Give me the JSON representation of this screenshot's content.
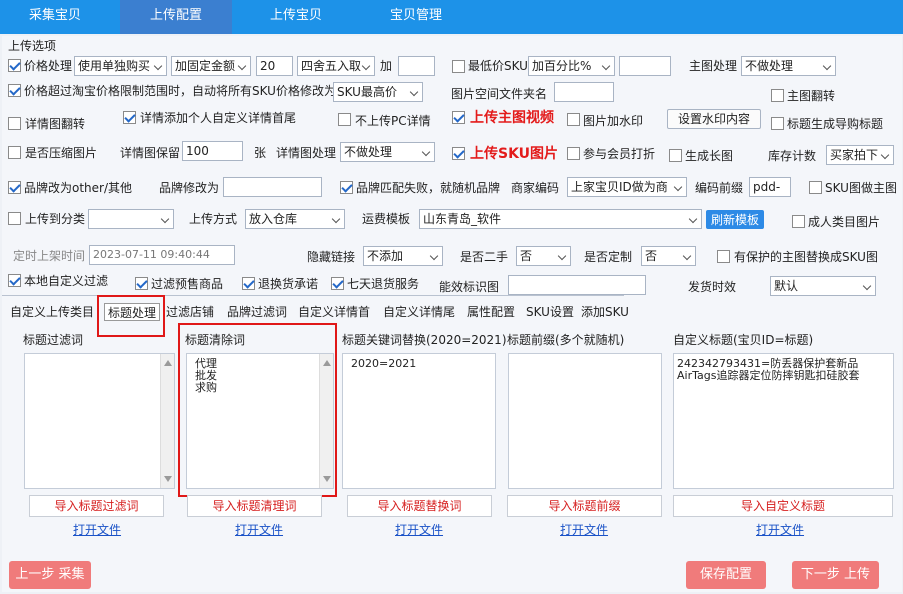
{
  "nav": {
    "tabs": [
      "采集宝贝",
      "上传配置",
      "上传宝贝",
      "宝贝管理"
    ]
  },
  "group_title": "上传选项",
  "row1": {
    "price_label": "价格处理",
    "price_mode": "使用单独购买",
    "fixed_mode": "加固定金额",
    "amount": "20",
    "rounding": "四舍五入取",
    "add": "加",
    "min_price": "最低价SKU",
    "pct": "加百分比%",
    "main_img": "主图处理",
    "main_img_val": "不做处理"
  },
  "row2": {
    "limit": "价格超过淘宝价格限制范围时，自动将所有SKU价格修改为",
    "limit_val": "SKU最高价",
    "folder": "图片空间文件夹名",
    "flip": "主图翻转"
  },
  "row3": {
    "detail_flip": "详情图翻转",
    "add_detail": "详情添加个人自定义详情首尾",
    "no_pc": "不上传PC详情",
    "upload_main_video": "上传主图视频",
    "watermark": "图片加水印",
    "set_watermark": "设置水印内容",
    "title_guide": "标题生成导购标题"
  },
  "row4": {
    "compress": "是否压缩图片",
    "keep": "详情图保留",
    "keep_val": "100",
    "unit": "张",
    "detail_proc": "详情图处理",
    "detail_proc_val": "不做处理",
    "upload_sku": "上传SKU图片",
    "vip": "参与会员打折",
    "long_img": "生成长图",
    "stock": "库存计数",
    "stock_val": "买家拍下"
  },
  "row5": {
    "brand_other": "品牌改为other/其他",
    "brand_change": "品牌修改为",
    "brand_random": "品牌匹配失败，就随机品牌",
    "merchant_code": "商家编码",
    "merchant_val": "上家宝贝ID做为商",
    "code_prefix": "编码前缀",
    "code_val": "pdd-",
    "sku_main": "SKU图做主图"
  },
  "row6": {
    "upload_cat": "上传到分类",
    "method": "上传方式",
    "method_val": "放入仓库",
    "freight": "运费模板",
    "freight_val": "山东青岛_软件",
    "refresh": "刷新模板",
    "adult": "成人类目图片"
  },
  "row7": {
    "schedule": "定时上架时间",
    "datetime": "2023-07-11 09:40:44",
    "hide_link": "隐藏链接",
    "hide_val": "不添加",
    "second": "是否二手",
    "second_val": "否",
    "custom": "是否定制",
    "custom_val": "否",
    "protect": "有保护的主图替换成SKU图"
  },
  "row8": {
    "local_filter": "本地自定义过滤",
    "presale": "过滤预售商品",
    "refund": "退换货承诺",
    "seven": "七天退货服务",
    "energy": "能效标识图",
    "ship_time": "发货时效",
    "ship_val": "默认"
  },
  "subtabs": [
    "自定义上传类目",
    "标题处理",
    "过滤店铺",
    "品牌过滤词",
    "自定义详情首",
    "自定义详情尾",
    "属性配置",
    "SKU设置",
    "添加SKU"
  ],
  "columns": [
    {
      "title": "标题过滤词",
      "content": "",
      "button": "导入标题过滤词",
      "link": "打开文件"
    },
    {
      "title": "标题清除词",
      "content": "代理\n批发\n求购",
      "button": "导入标题清理词",
      "link": "打开文件"
    },
    {
      "title": "标题关键词替换(2020=2021)",
      "content": "2020=2021",
      "button": "导入标题替换词",
      "link": "打开文件"
    },
    {
      "title": "标题前缀(多个就随机)",
      "content": "",
      "button": "导入标题前缀",
      "link": "打开文件"
    },
    {
      "title": "自定义标题(宝贝ID=标题)",
      "content": "242342793431=防丢器保护套新品\nAirTags追踪器定位防摔钥匙扣硅胶套",
      "button": "导入自定义标题",
      "link": "打开文件"
    }
  ],
  "footer": {
    "prev": "上一步 采集",
    "save": "保存配置",
    "next": "下一步 上传"
  }
}
